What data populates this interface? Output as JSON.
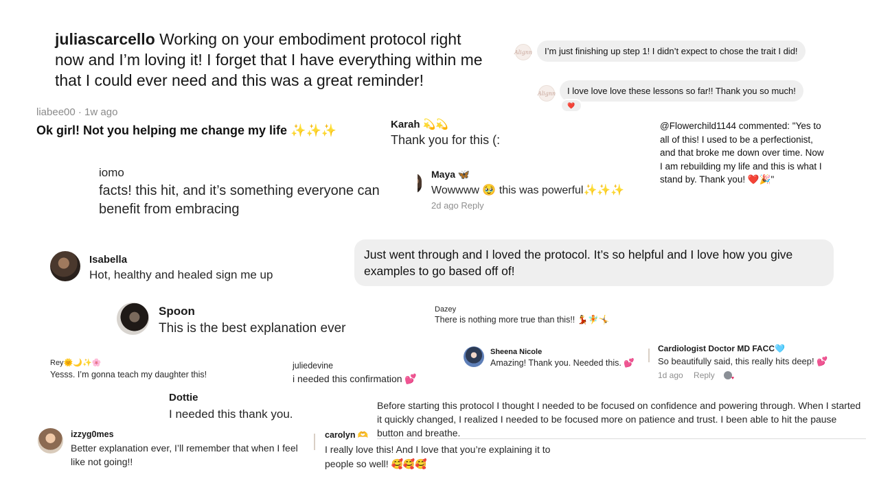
{
  "comments": {
    "julia": {
      "user": "juliascarcello",
      "text": "Working on your embodiment protocol right now and I’m loving it! I forget that I have everything within me that I could ever need and this was a great reminder!"
    },
    "dm1": {
      "text": "I’m just finishing up step 1! I didn’t expect to chose the trait I did!"
    },
    "dm2": {
      "text": "I love love love these lessons so far!! Thank you so much!",
      "reaction": "❤️"
    },
    "liabee": {
      "user": "liabee00",
      "time": "· 1w ago",
      "text": "Ok girl! Not you helping me change my life ✨✨✨"
    },
    "karah": {
      "user": "Karah 💫💫",
      "text": "Thank you for this (:"
    },
    "flower": {
      "text": "@Flowerchild1144 commented: \"Yes to all of this! I used to be a perfectionist, and that broke me down over time. Now I am rebuilding my life and this is what I stand by. Thank you! ❤️🎉\""
    },
    "iomo": {
      "user": "iomo",
      "text": "facts! this hit, and it’s something everyone can benefit from embracing"
    },
    "maya": {
      "user": "Maya 🦋",
      "text": "Wowwww 🥹 this was powerful✨✨✨",
      "meta": "2d ago   Reply"
    },
    "protocol_bubble": {
      "text": "Just went through and I loved the protocol. It’s so helpful and I love how you give examples to go based off of!"
    },
    "isabella": {
      "user": "Isabella",
      "text": "Hot, healthy and healed sign me up"
    },
    "spoon": {
      "user": "Spoon",
      "text": "This is the best explanation ever"
    },
    "dazey": {
      "user": "Dazey",
      "text": "There is nothing more true than this!! 💃🧚🤸"
    },
    "sheena": {
      "user": "Sheena Nicole",
      "text": "Amazing! Thank you. Needed this. 💕"
    },
    "cardio": {
      "user": "Cardiologist Doctor MD FACC🩵",
      "text": "So beautifully said, this really hits deep! 💕",
      "time": "1d ago",
      "reply": "Reply"
    },
    "rey": {
      "user": "Rey🌞🌙✨🌸",
      "text": "Yesss. I’m gonna teach my daughter this!"
    },
    "juliedevine": {
      "user": "juliedevine",
      "text": "i needed this confirmation 💕"
    },
    "dottie": {
      "user": "Dottie",
      "text": "I needed this thank you."
    },
    "before": {
      "text": "Before starting this protocol I thought I needed to be focused on confidence and powering through. When I started it quickly changed, I realized I needed to be focused more on patience and trust. I been able to hit the pause button and breathe."
    },
    "izzy": {
      "user": "izzyg0mes",
      "text": "Better explanation ever, I’ll remember that when I feel like not going!!"
    },
    "carolyn": {
      "user": "carolyn 🫶",
      "text": "I really love this! And I love that you’re explaining it to people so well! 🥰🥰🥰"
    }
  },
  "avatar_logo_text": "Alignn"
}
